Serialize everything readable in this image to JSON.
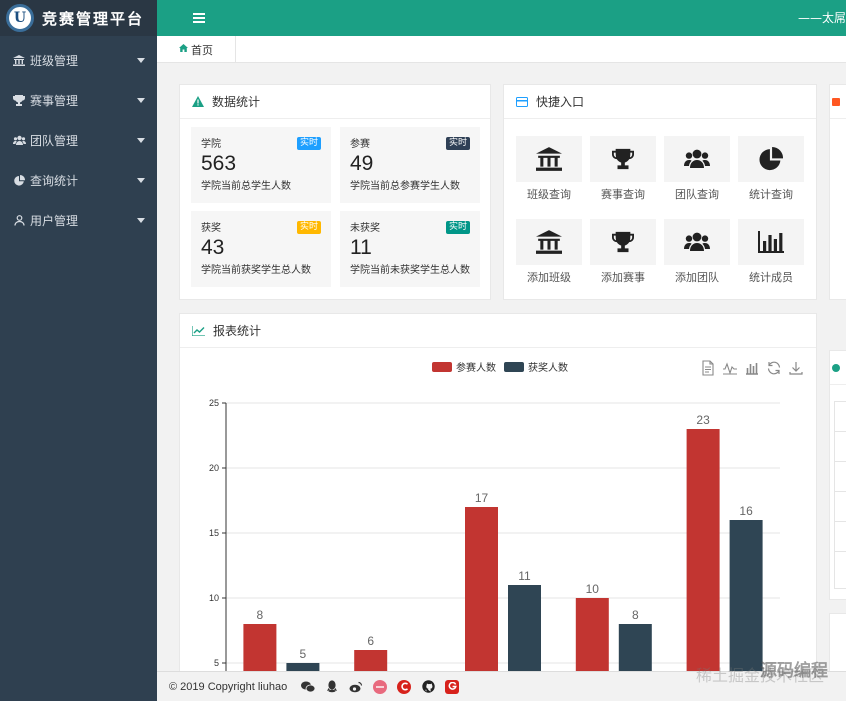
{
  "app": {
    "title": "竞赛管理平台",
    "logo_letter": "U"
  },
  "sidebar": {
    "items": [
      {
        "label": "班级管理",
        "icon": "bank-icon"
      },
      {
        "label": "赛事管理",
        "icon": "trophy-icon"
      },
      {
        "label": "团队管理",
        "icon": "users-icon"
      },
      {
        "label": "查询统计",
        "icon": "pie-icon"
      },
      {
        "label": "用户管理",
        "icon": "user-icon"
      }
    ]
  },
  "header": {
    "right_text": "——太屌"
  },
  "tabs": [
    {
      "label": "首页",
      "icon": "home-icon"
    }
  ],
  "stats_panel": {
    "title": "数据统计",
    "cards": [
      {
        "title": "学院",
        "badge": "实时",
        "badge_color": "#1e9fff",
        "value": "563",
        "desc": "学院当前总学生人数"
      },
      {
        "title": "参赛",
        "badge": "实时",
        "badge_color": "#2f4056",
        "value": "49",
        "desc": "学院当前总参赛学生人数"
      },
      {
        "title": "获奖",
        "badge": "实时",
        "badge_color": "#ffb800",
        "value": "43",
        "desc": "学院当前获奖学生总人数"
      },
      {
        "title": "未获奖",
        "badge": "实时",
        "badge_color": "#009688",
        "value": "11",
        "desc": "学院当前未获奖学生总人数"
      }
    ]
  },
  "quick_panel": {
    "title": "快捷入口",
    "items": [
      {
        "label": "班级查询",
        "icon": "bank-icon"
      },
      {
        "label": "赛事查询",
        "icon": "trophy-icon"
      },
      {
        "label": "团队查询",
        "icon": "users-icon"
      },
      {
        "label": "统计查询",
        "icon": "pie-chart-icon"
      },
      {
        "label": "添加班级",
        "icon": "bank-icon"
      },
      {
        "label": "添加赛事",
        "icon": "trophy-icon"
      },
      {
        "label": "添加团队",
        "icon": "users-icon"
      },
      {
        "label": "统计成员",
        "icon": "bar-chart-icon"
      }
    ]
  },
  "report_panel": {
    "title": "报表统计"
  },
  "chart_data": {
    "type": "bar",
    "title": "",
    "xlabel": "",
    "ylabel": "",
    "ylim": [
      0,
      25
    ],
    "yticks": [
      25,
      20,
      15,
      10,
      5
    ],
    "grid": true,
    "legend_position": "top",
    "series": [
      {
        "name": "参赛人数",
        "color": "#c23531",
        "values": [
          8,
          6,
          17,
          10,
          23
        ]
      },
      {
        "name": "获奖人数",
        "color": "#2f4554",
        "values": [
          5,
          null,
          11,
          8,
          16
        ]
      }
    ],
    "toolbox": [
      "data-view-icon",
      "line-switch-icon",
      "bar-switch-icon",
      "restore-icon",
      "save-image-icon"
    ]
  },
  "footer": {
    "copyright": "© 2019 Copyright liuhao",
    "icons": [
      "wechat-icon",
      "qq-icon",
      "weibo-icon",
      "lofter-icon",
      "csdn-icon",
      "github-icon",
      "google-icon"
    ]
  },
  "watermark": {
    "main": "源码编程",
    "sub": "稀土掘金技术社区"
  }
}
